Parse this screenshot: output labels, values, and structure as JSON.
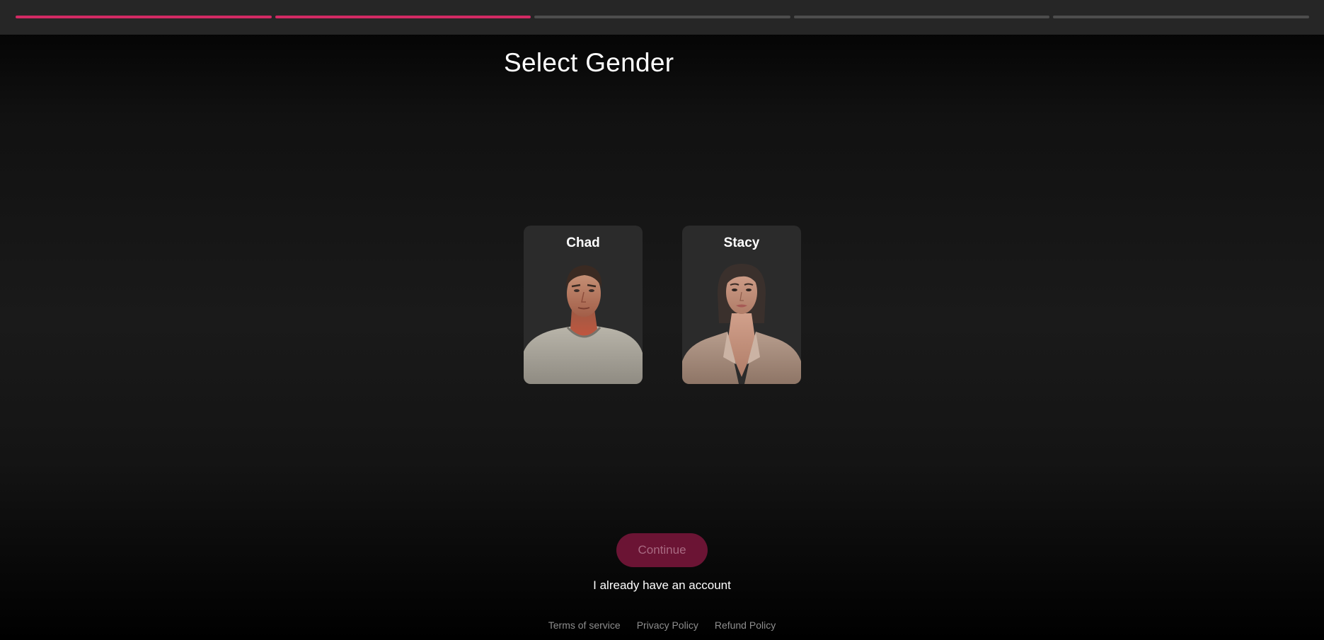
{
  "progress": {
    "total_steps": 5,
    "completed_steps": 2,
    "active_color": "#d22a64",
    "inactive_color": "#4d4d4d"
  },
  "page": {
    "title": "Select Gender"
  },
  "options": [
    {
      "label": "Chad",
      "image": "male-portrait"
    },
    {
      "label": "Stacy",
      "image": "female-portrait"
    }
  ],
  "actions": {
    "continue_label": "Continue",
    "continue_disabled": true,
    "login_label": "I already have an account"
  },
  "footer": {
    "links": [
      "Terms of service",
      "Privacy Policy",
      "Refund Policy"
    ]
  },
  "colors": {
    "accent": "#d22a64",
    "button_disabled_bg": "#6b1434"
  }
}
